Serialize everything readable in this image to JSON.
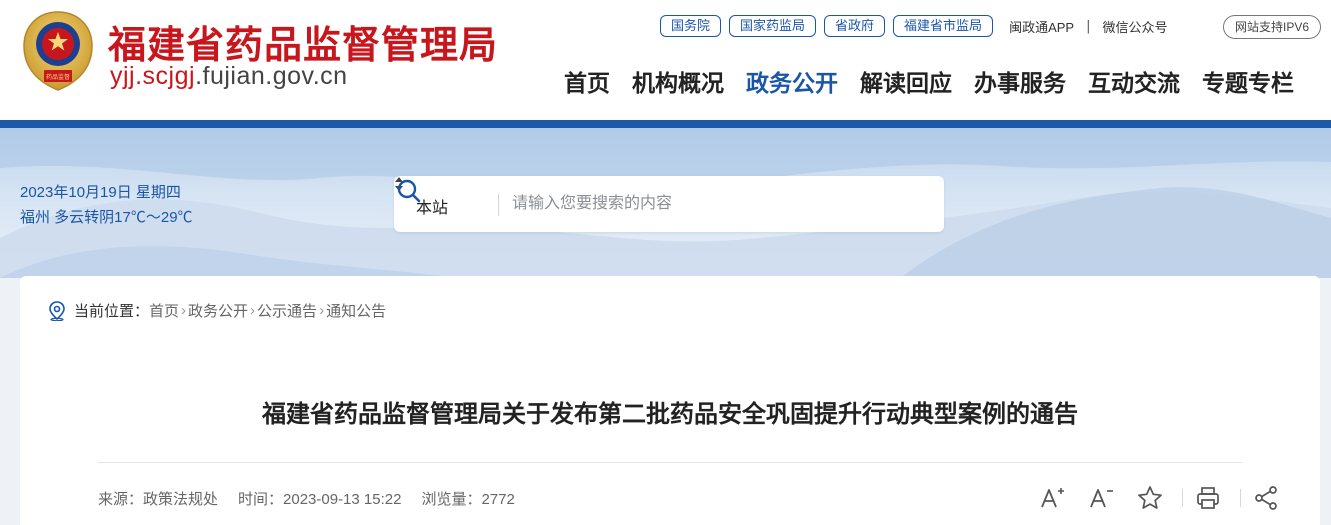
{
  "header": {
    "site_name": "福建省药品监督管理局",
    "domain_red": "yjj.scjgj",
    "domain_rest": ".fujian.gov.cn",
    "top_links": [
      "国务院",
      "国家药监局",
      "省政府",
      "福建省市监局"
    ],
    "app_link": "闽政通APP",
    "separator": "|",
    "wechat_link": "微信公众号",
    "ipv6_badge": "网站支持IPV6",
    "nav": [
      "首页",
      "机构概况",
      "政务公开",
      "解读回应",
      "办事服务",
      "互动交流",
      "专题专栏"
    ],
    "active_nav": "政务公开",
    "emblem_text": "药品监督"
  },
  "banner": {
    "date": "2023年10月19日 星期四",
    "weather": "福州 多云转阴17℃～29℃"
  },
  "search": {
    "scope": "本站",
    "placeholder": "请输入您要搜索的内容"
  },
  "breadcrumb": {
    "label": "当前位置：",
    "items": [
      "首页",
      "政务公开",
      "公示通告",
      "通知公告"
    ],
    "arrow": "›"
  },
  "article": {
    "title": "福建省药品监督管理局关于发布第二批药品安全巩固提升行动典型案例的通告",
    "source": "来源：政策法规处",
    "time": "时间：2023-09-13 15:22",
    "views": "浏览量：2772"
  },
  "tools": [
    "font-increase-icon",
    "font-decrease-icon",
    "favorite-star-icon",
    "print-icon",
    "share-icon"
  ],
  "colors": {
    "brand_red": "#c8161d",
    "brand_blue": "#1a56a8",
    "bar_blue": "#1b5aa6"
  }
}
